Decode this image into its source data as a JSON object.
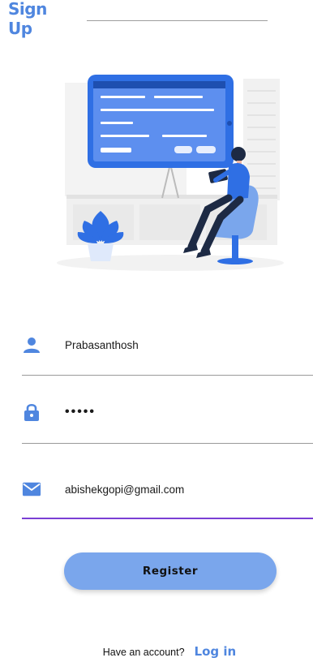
{
  "header": {
    "title": "Sign Up"
  },
  "form": {
    "username": "Prabasanthosh",
    "password": "•••••",
    "email": "abishekgopi@gmail.com",
    "register_label": "Register"
  },
  "footer": {
    "question": "Have an account?",
    "login_label": "Log in"
  },
  "colors": {
    "accent": "#4f86df",
    "button": "#7aa6ec",
    "active_underline": "#7a3fd4"
  },
  "icons": [
    "person-icon",
    "lock-icon",
    "mail-icon"
  ]
}
